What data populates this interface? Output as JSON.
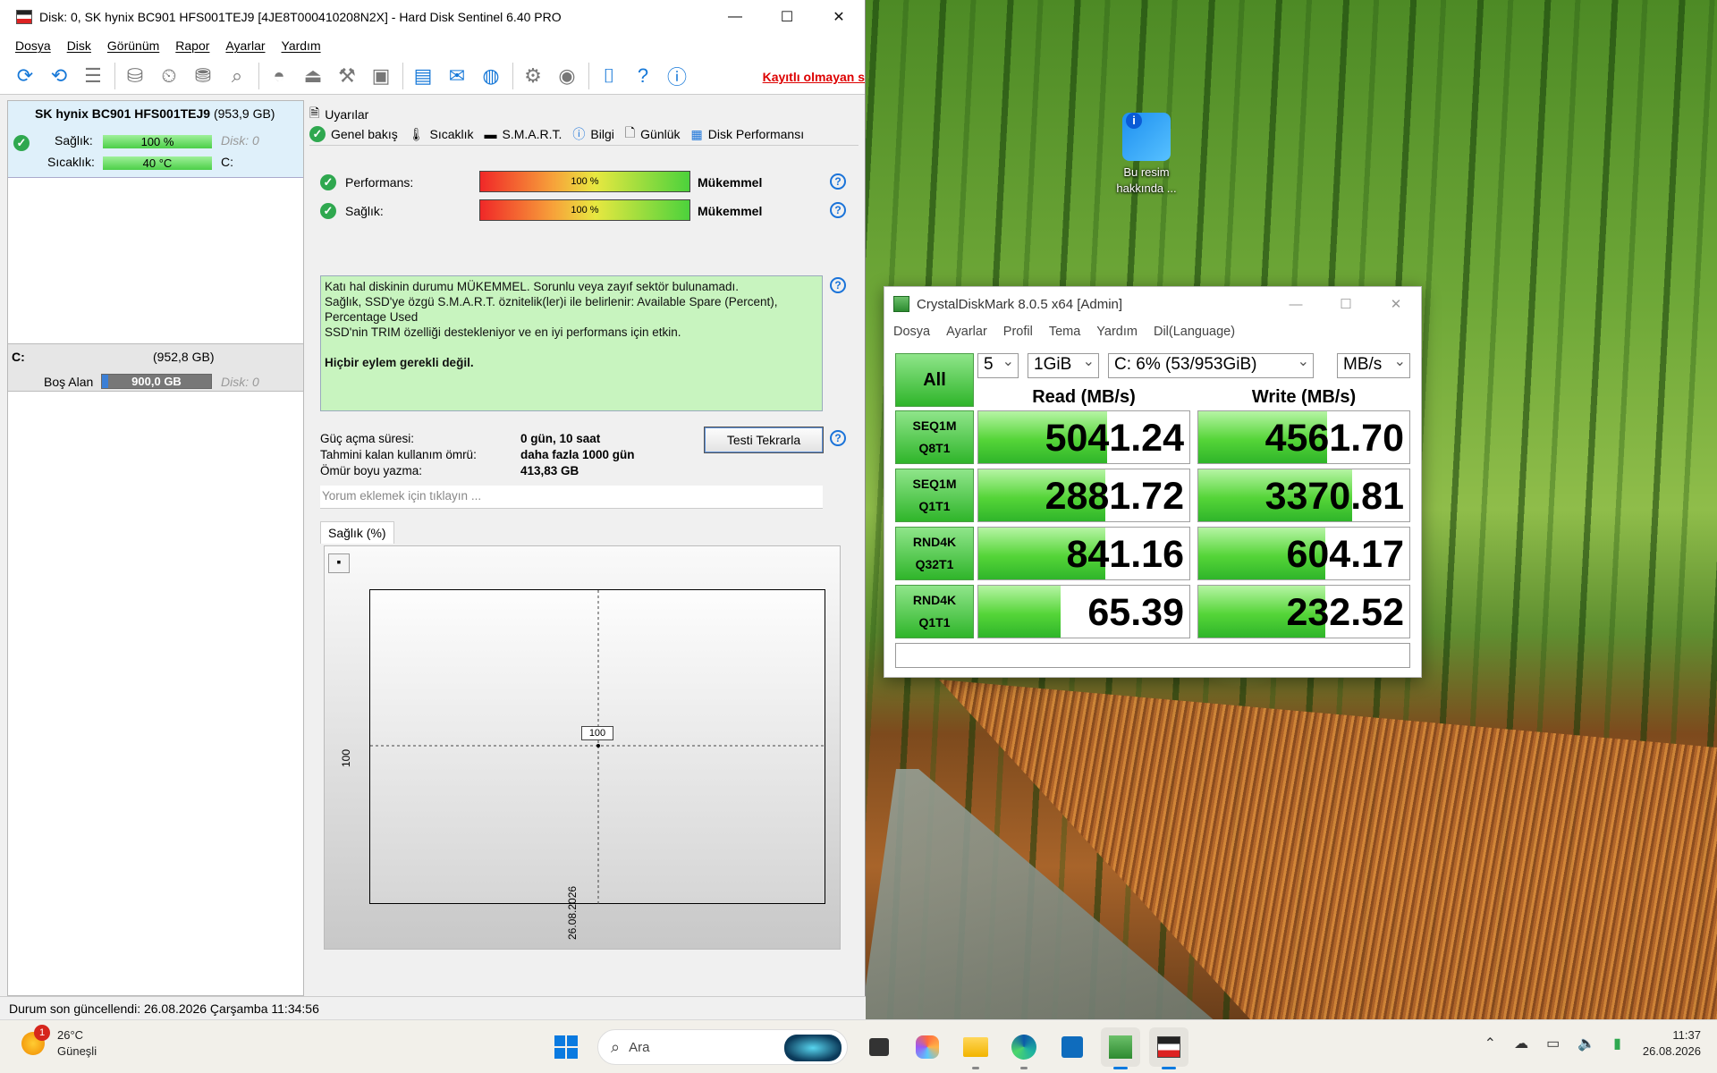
{
  "desktop": {
    "icon_label": "Bu resim hakkında ..."
  },
  "hds": {
    "title": "Disk: 0, SK hynix BC901 HFS001TEJ9 [4JE8T000410208N2X]  -  Hard Disk Sentinel 6.40 PRO",
    "menu": [
      "Dosya",
      "Disk",
      "Görünüm",
      "Rapor",
      "Ayarlar",
      "Yardım"
    ],
    "unregistered": "Kayıtlı olmayan s",
    "disk": {
      "name": "SK hynix BC901 HFS001TEJ9",
      "size": "(953,9 GB)",
      "health_label": "Sağlık:",
      "health_value": "100 %",
      "health_disk": "Disk: 0",
      "temp_label": "Sıcaklık:",
      "temp_value": "40 °C",
      "temp_drive": "C:"
    },
    "volume": {
      "letter": "C:",
      "size": "(952,8 GB)",
      "free_label": "Boş Alan",
      "free_value": "900,0 GB",
      "disk": "Disk: 0",
      "free_fraction": 0.055
    },
    "tabs_row1": [
      "Uyarılar"
    ],
    "tabs_row2": [
      "Genel bakış",
      "Sıcaklık",
      "S.M.A.R.T.",
      "Bilgi",
      "Günlük",
      "Disk Performansı"
    ],
    "performance": {
      "label": "Performans:",
      "value": "100 %",
      "rating": "Mükemmel"
    },
    "health": {
      "label": "Sağlık:",
      "value": "100 %",
      "rating": "Mükemmel"
    },
    "status_lines": [
      "Katı hal diskinin durumu MÜKEMMEL. Sorunlu veya zayıf sektör bulunamadı.",
      "Sağlık, SSD'ye özgü S.M.A.R.T. öznitelik(ler)i ile belirlenir:  Available Spare (Percent),",
      "Percentage Used",
      "SSD'nin TRIM özelliği destekleniyor ve en iyi performans için etkin."
    ],
    "status_action": "Hiçbir eylem gerekli değil.",
    "power_on_label": "Güç açma süresi:",
    "power_on_value": "0 gün, 10 saat",
    "remaining_label": "Tahmini kalan kullanım ömrü:",
    "remaining_value": "daha fazla 1000 gün",
    "written_label": "Ömür boyu yazma:",
    "written_value": "413,83 GB",
    "retest_button": "Testi Tekrarla",
    "comment_placeholder": "Yorum eklemek için tıklayın ...",
    "chart_tab": "Sağlık (%)",
    "chart_y_label": "100",
    "chart_point_label": "100",
    "chart_x_label": "26.08.2026",
    "statusbar": "Durum son güncellendi: 26.08.2026 Çarşamba 11:34:56"
  },
  "cdm": {
    "title": "CrystalDiskMark 8.0.5 x64 [Admin]",
    "menu": [
      "Dosya",
      "Ayarlar",
      "Profil",
      "Tema",
      "Yardım",
      "Dil(Language)"
    ],
    "all_button": "All",
    "count": "5",
    "size": "1GiB",
    "drive": "C: 6% (53/953GiB)",
    "unit": "MB/s",
    "read_header": "Read (MB/s)",
    "write_header": "Write (MB/s)",
    "rows": [
      {
        "l1": "SEQ1M",
        "l2": "Q8T1",
        "read": "5041.24",
        "write": "4561.70",
        "rf": 0.61,
        "wf": 0.61
      },
      {
        "l1": "SEQ1M",
        "l2": "Q1T1",
        "read": "2881.72",
        "write": "3370.81",
        "rf": 0.6,
        "wf": 0.73
      },
      {
        "l1": "RND4K",
        "l2": "Q32T1",
        "read": "841.16",
        "write": "604.17",
        "rf": 0.6,
        "wf": 0.6
      },
      {
        "l1": "RND4K",
        "l2": "Q1T1",
        "read": "65.39",
        "write": "232.52",
        "rf": 0.39,
        "wf": 0.6
      }
    ]
  },
  "taskbar": {
    "weather_temp": "26°C",
    "weather_desc": "Güneşli",
    "weather_badge": "1",
    "search": "Ara",
    "time": "11:37",
    "date": "26.08.2026"
  }
}
